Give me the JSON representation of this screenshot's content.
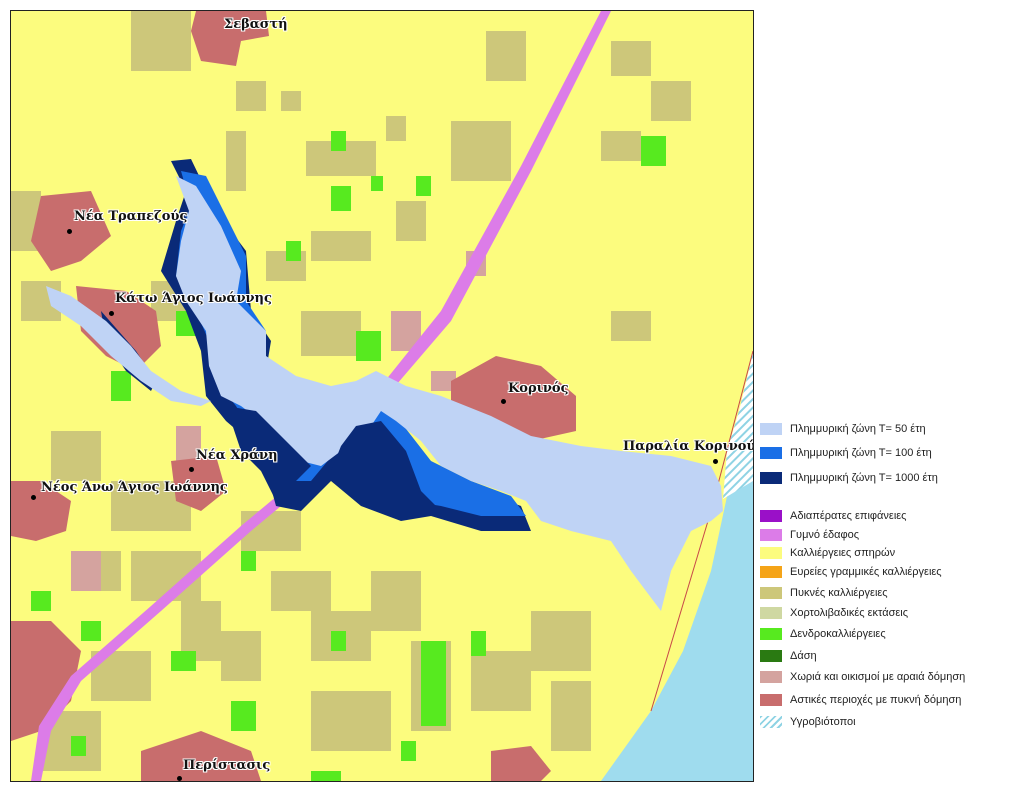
{
  "colors": {
    "crops": "#fcfc7e",
    "dense_crops": "#cdc77a",
    "tree_crops": "#57ea1f",
    "urban": "#c86d6d",
    "villages": "#d4a39f",
    "bare_soil": "#dc7ce8",
    "sea": "#9fdcee",
    "flood_50": "#bfd3f5",
    "flood_100": "#1a6fe6",
    "flood_1000": "#0a2a78"
  },
  "towns": [
    {
      "name": "Σεβαστή"
    },
    {
      "name": "Νέα Τραπεζούς"
    },
    {
      "name": "Κάτω Άγιος Ιωάννης"
    },
    {
      "name": "Κορινός"
    },
    {
      "name": "Παραλία Κορινού"
    },
    {
      "name": "Νέα Χράνη"
    },
    {
      "name": "Νέος Άνω Άγιος Ιωάννης"
    },
    {
      "name": "Περίστασις"
    }
  ],
  "legend": {
    "flood_zones": [
      {
        "label": "Πλημμυρική ζώνη Τ= 50 έτη",
        "color": "#bfd3f5"
      },
      {
        "label": "Πλημμυρική ζώνη Τ= 100 έτη",
        "color": "#1a6fe6"
      },
      {
        "label": "Πλημμυρική ζώνη Τ= 1000 έτη",
        "color": "#0a2a78"
      }
    ],
    "land_use": [
      {
        "label": "Αδιαπέρατες επιφάνειες",
        "color": "#9a10c8"
      },
      {
        "label": "Γυμνό έδαφος",
        "color": "#dc7ce8"
      },
      {
        "label": "Καλλιέργειες σπηρών",
        "color": "#fcfc7e"
      },
      {
        "label": "Ευρείες γραμμικές καλλιέργειες",
        "color": "#f5a418"
      },
      {
        "label": "Πυκνές καλλιέργειες",
        "color": "#cdc77a"
      },
      {
        "label": "Χορτολιβαδικές εκτάσεις",
        "color": "#cfd8a2"
      },
      {
        "label": "Δενδροκαλλιέργειες",
        "color": "#57ea1f"
      },
      {
        "label": "Δάση",
        "color": "#2a7a12"
      },
      {
        "label": "Χωριά και οικισμοί με αραιά δόμηση",
        "color": "#d4a39f"
      },
      {
        "label": "Αστικές περιοχές με πυκνή δόμηση",
        "color": "#c86d6d"
      },
      {
        "label": "Υγροβιότοποι",
        "color": "hatch"
      }
    ]
  }
}
